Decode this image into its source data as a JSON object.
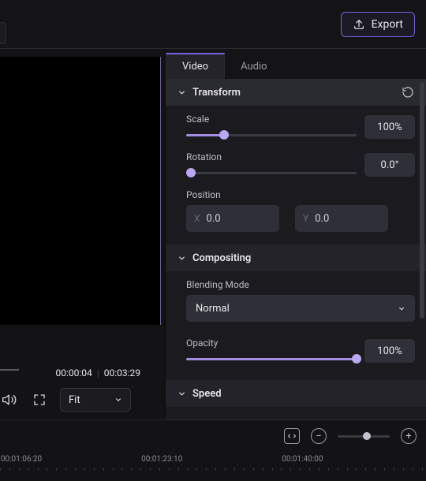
{
  "header": {
    "export_label": "Export"
  },
  "preview": {
    "current_time": "00:00:04",
    "duration": "00:03:29",
    "fit_mode": "Fit"
  },
  "properties": {
    "tabs": [
      {
        "label": "Video",
        "active": true
      },
      {
        "label": "Audio",
        "active": false
      }
    ],
    "transform": {
      "title": "Transform",
      "scale_label": "Scale",
      "scale_value": "100%",
      "scale_pct": 22,
      "rotation_label": "Rotation",
      "rotation_value": "0.0°",
      "rotation_pct": 3,
      "position_label": "Position",
      "pos_x_value": "0.0",
      "pos_y_value": "0.0"
    },
    "compositing": {
      "title": "Compositing",
      "blend_label": "Blending Mode",
      "blend_value": "Normal",
      "opacity_label": "Opacity",
      "opacity_value": "100%",
      "opacity_pct": 100
    },
    "speed": {
      "title": "Speed"
    }
  },
  "timeline": {
    "zoom_pct": 56,
    "ticks": [
      {
        "label": "00:01:06:20",
        "pos": 5
      },
      {
        "label": "00:01:23:10",
        "pos": 38
      },
      {
        "label": "00:01:40:00",
        "pos": 71
      }
    ]
  }
}
